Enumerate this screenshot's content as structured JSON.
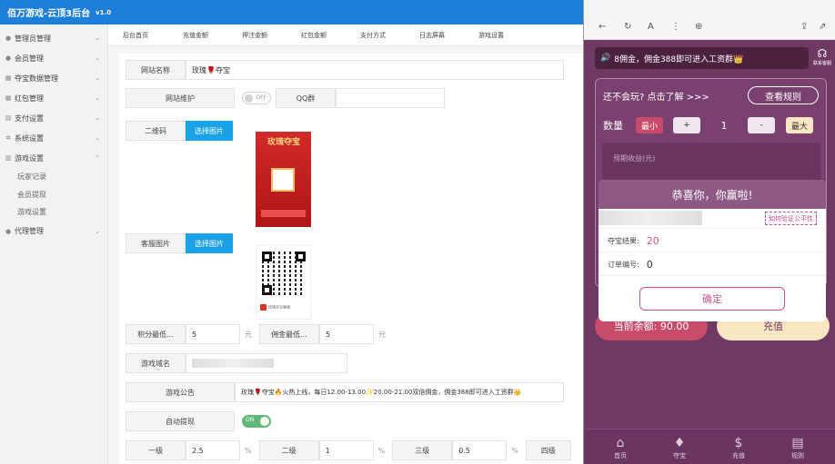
{
  "admin": {
    "title": "佰万游戏-云顶3后台",
    "version": "v1.0"
  },
  "sidebar": {
    "items": [
      {
        "label": "管理员管理"
      },
      {
        "label": "会员管理"
      },
      {
        "label": "夺宝数据管理"
      },
      {
        "label": "红包管理"
      },
      {
        "label": "支付设置"
      },
      {
        "label": "系统设置"
      },
      {
        "label": "游戏设置"
      },
      {
        "label": "代理管理"
      }
    ],
    "sub_items": [
      "玩家记录",
      "会员提现",
      "游戏设置"
    ]
  },
  "tabs": [
    "后台首页",
    "充值金额",
    "押注金额",
    "红包金额",
    "支付方式",
    "日志屏幕",
    "游戏设置"
  ],
  "form": {
    "site_name_label": "网站名称",
    "site_name_value": "玫瑰🌹夺宝",
    "maintenance_label": "网站维护",
    "maintenance_toggle": "OFF",
    "qq_group_label": "QQ群",
    "qrcode_label": "二维码",
    "select_image": "选择图片",
    "service_image_label": "客服图片",
    "poster_text": "玫瑰夺宝",
    "qr_footer_text": "玫瑰夺宝客服",
    "points_min_label": "积分最低...",
    "points_min_value": "5",
    "commission_min_label": "佣金最低...",
    "commission_min_value": "5",
    "unit_yuan": "元",
    "game_domain_label": "游戏域名",
    "announcement_label": "游戏公告",
    "announcement_value": "玫瑰🌹夺宝🔥火热上线，每日12.00-13.00✨20.00-21.00双倍佣金，佣金388即可进入工资群👑",
    "auto_withdraw_label": "自动提现",
    "auto_withdraw_toggle": "ON",
    "level1_label": "一级",
    "level1_value": "2.5",
    "level2_label": "二级",
    "level2_value": "1",
    "level3_label": "三级",
    "level3_value": "0.5",
    "level4_label": "四级",
    "percent": "%"
  },
  "phone": {
    "marquee": "8佣金，佣金388即可进入工资群👑",
    "service_label": "联系客服",
    "question": "还不会玩? 点击了解 >>>",
    "rules_button": "查看规则",
    "qty_label": "数量",
    "min_button": "最小",
    "plus_button": "+",
    "qty_value": "1",
    "minus_button": "-",
    "max_button": "最大",
    "estimate_label": "预期收益(元)",
    "balance": "当前余额: 90.00",
    "recharge": "充值",
    "dialog": {
      "title": "恭喜你，你赢啦!",
      "verify_link": "如何验证公平性",
      "result_label": "夺宝结果:",
      "result_value": "20",
      "order_label": "订单编号:",
      "order_value": "0",
      "confirm": "确定"
    },
    "nav": [
      "首页",
      "夺宝",
      "充值",
      "规则"
    ]
  },
  "colors": {
    "admin_topbar": "#1e7fd8",
    "phone_bg": "#6e3a63",
    "accent_pink": "#c9548d",
    "toggle_on": "#5fb878"
  }
}
